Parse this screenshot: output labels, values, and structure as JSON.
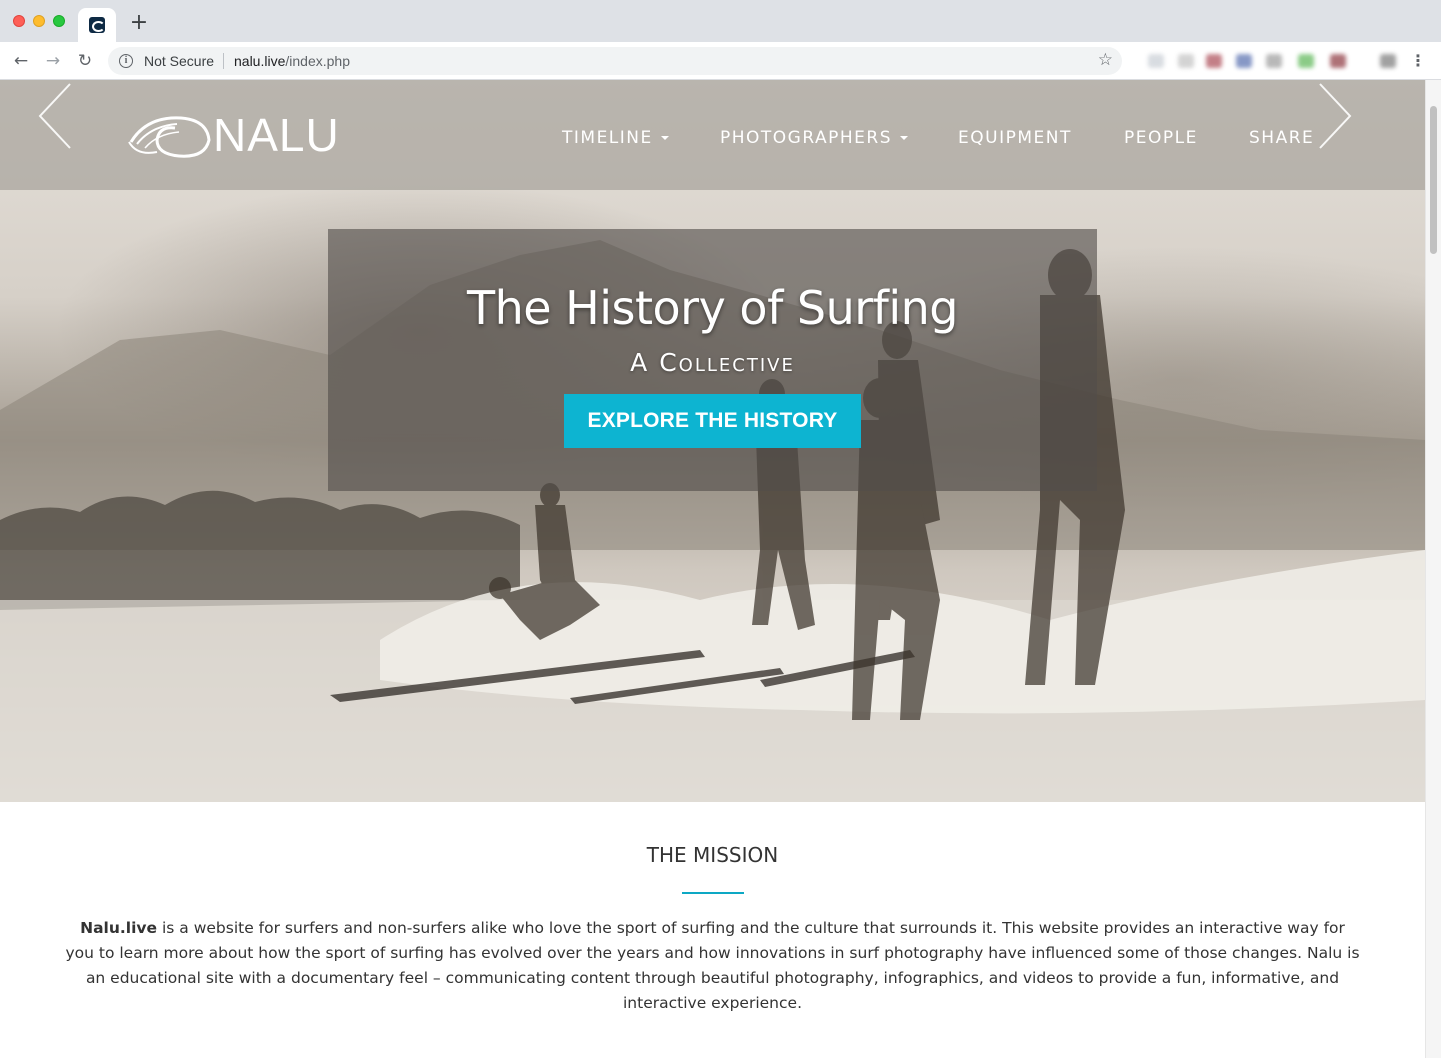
{
  "browser": {
    "security_text": "Not Secure",
    "url_host": "nalu.live",
    "url_path": "/index.php",
    "new_tab": "+"
  },
  "site": {
    "logo_text": "NALU",
    "nav": [
      {
        "label": "TIMELINE",
        "dropdown": true
      },
      {
        "label": "PHOTOGRAPHERS",
        "dropdown": true
      },
      {
        "label": "EQUIPMENT",
        "dropdown": false
      },
      {
        "label": "PEOPLE",
        "dropdown": false
      },
      {
        "label": "SHARE",
        "dropdown": false
      }
    ]
  },
  "hero": {
    "title": "The History of Surfing",
    "subtitle": "A Collective",
    "cta_label": "EXPLORE THE HISTORY"
  },
  "mission": {
    "title": "THE MISSION",
    "brand": "Nalu.live",
    "body": " is a website for surfers and non-surfers alike who love the sport of surfing and the culture that surrounds it. This website provides an interactive way for you to learn more about how the sport of surfing has evolved over the years and how innovations in surf photography have influenced some of those changes. Nalu is an educational site with a documentary feel – communicating content through beautiful photography, infographics, and videos to provide a fun, informative, and interactive experience."
  },
  "colors": {
    "accent": "#0db4d1",
    "navbar_bg": "#a8a39d",
    "text": "#333333"
  },
  "icons": [
    "close-dot",
    "minimize-dot",
    "zoom-dot",
    "favicon",
    "back-arrow-icon",
    "forward-arrow-icon",
    "reload-icon",
    "info-icon",
    "star-icon",
    "kebab-menu-icon",
    "wave-logo-icon",
    "chevron-left-icon",
    "chevron-right-icon"
  ]
}
